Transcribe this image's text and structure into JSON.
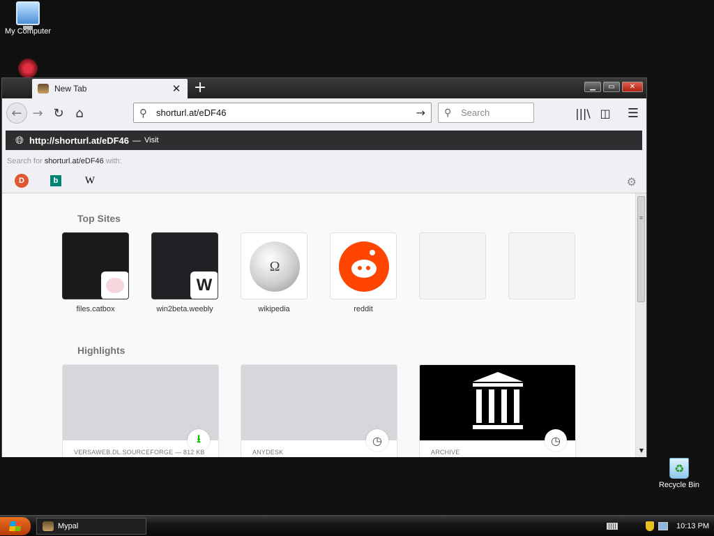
{
  "desktop": {
    "icons": [
      {
        "label": "My Computer"
      },
      {
        "label": ""
      },
      {
        "label": "Recycle Bin"
      }
    ]
  },
  "browser": {
    "tab": {
      "title": "New Tab",
      "close": "✕"
    },
    "newtab_symbol": "+",
    "window_controls": {
      "minimize": "▁",
      "maximize": "▭",
      "close": "✕"
    },
    "nav": {
      "back": "←",
      "forward": "→",
      "reload": "↻",
      "home": "⌂"
    },
    "urlbar": {
      "icon": "⚲",
      "value": "shorturl.at/eDF46",
      "go": "→"
    },
    "searchbar": {
      "icon": "⚲",
      "placeholder": "Search"
    },
    "toolbar": {
      "library": "|||\\",
      "sidebar": "◫",
      "menu": "☰"
    }
  },
  "url_popup": {
    "visit_url": "http://shorturl.at/eDF46",
    "visit_dash": "—",
    "visit_label": "Visit",
    "search_for_prefix": "Search for",
    "search_for_query": "shorturl.at/eDF46",
    "search_for_suffix": "with:",
    "engines": [
      {
        "name": "duckduckgo",
        "glyph": "D"
      },
      {
        "name": "bing",
        "glyph": "b"
      },
      {
        "name": "wikipedia",
        "glyph": "W"
      }
    ],
    "settings_icon": "⚙"
  },
  "new_tab_page": {
    "top_sites_title": "Top Sites",
    "top_sites": [
      {
        "label": "files.catbox"
      },
      {
        "label": "win2beta.weebly",
        "badge": "W"
      },
      {
        "label": "wikipedia",
        "glyph": "Ω"
      },
      {
        "label": "reddit"
      },
      {
        "label": ""
      },
      {
        "label": ""
      }
    ],
    "highlights_title": "Highlights",
    "highlights": [
      {
        "caption": "VERSAWEB.DL.SOURCEFORGE — 812 KB",
        "icon": "⭳",
        "icon_name": "download-icon"
      },
      {
        "caption": "ANYDESK",
        "icon": "◷",
        "icon_name": "clock-icon"
      },
      {
        "caption": "ARCHIVE",
        "icon": "◷",
        "icon_name": "clock-icon"
      }
    ]
  },
  "scrollbar": {
    "grip": "≡",
    "down": "▼"
  },
  "taskbar": {
    "task": "Mypal",
    "clock": "10:13 PM"
  }
}
